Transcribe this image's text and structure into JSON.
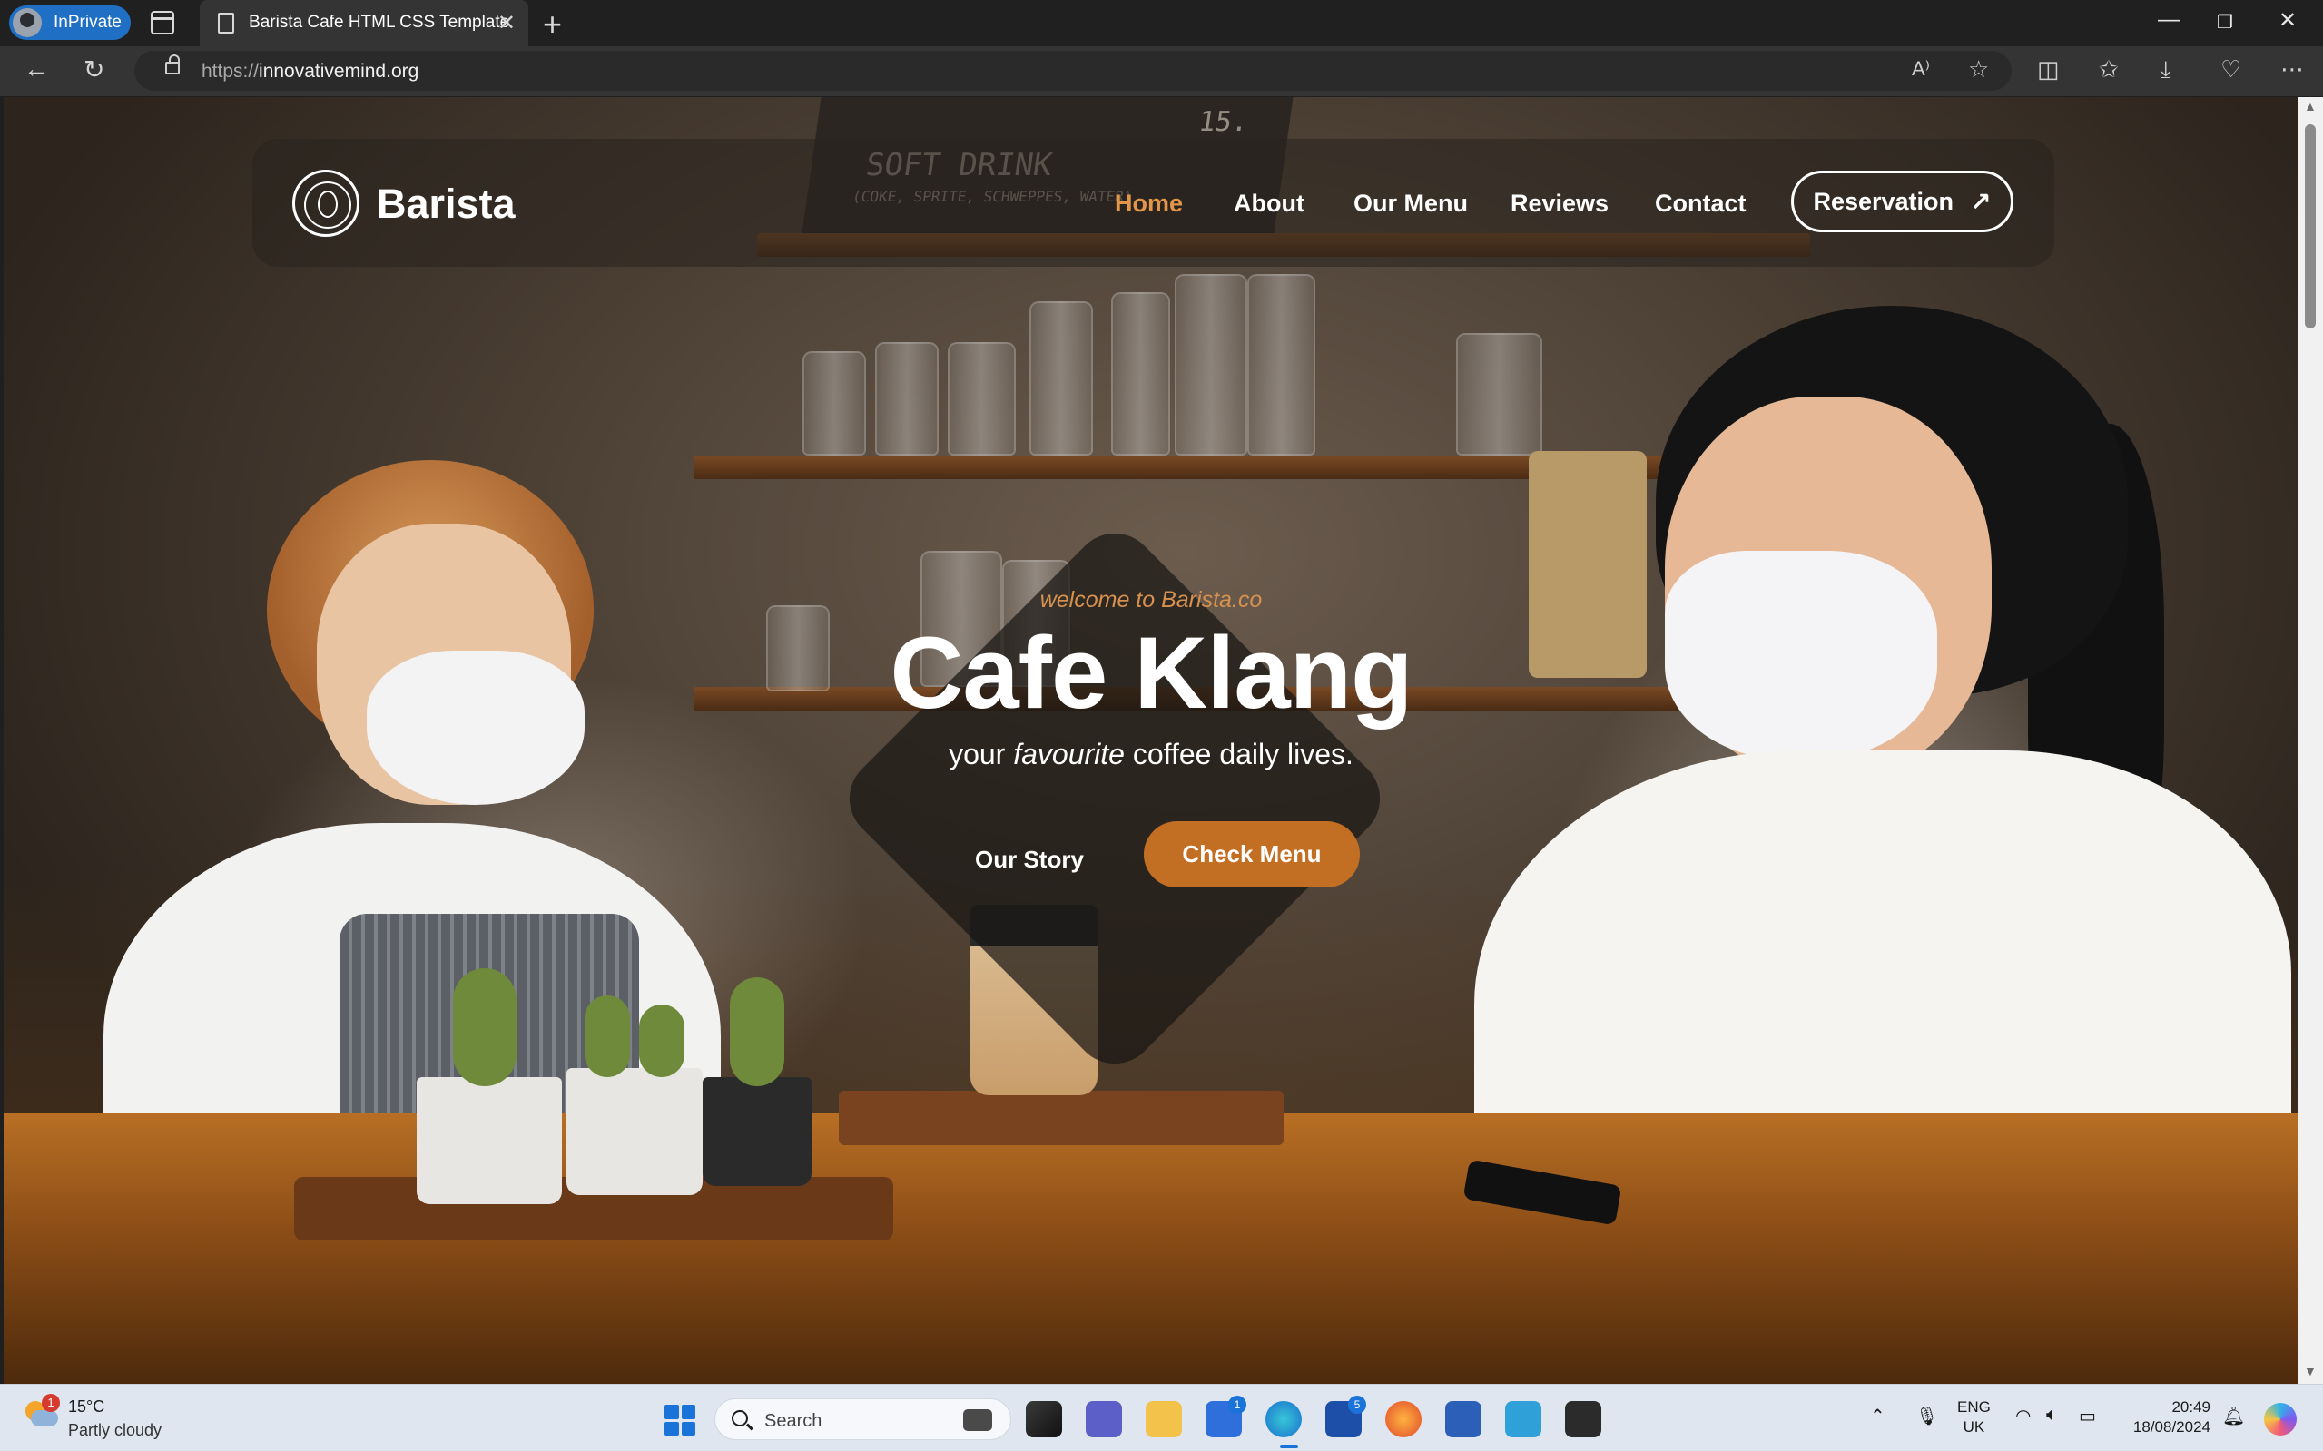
{
  "browser": {
    "inprivate_label": "InPrivate",
    "tab_title": "Barista Cafe HTML CSS Template",
    "url_protocol": "https://",
    "url_host": "innovativemind.org"
  },
  "site": {
    "brand": "Barista",
    "nav": [
      {
        "label": "Home",
        "active": true
      },
      {
        "label": "About",
        "active": false
      },
      {
        "label": "Our Menu",
        "active": false
      },
      {
        "label": "Reviews",
        "active": false
      },
      {
        "label": "Contact",
        "active": false
      }
    ],
    "reservation_label": "Reservation",
    "accent_color": "#e3954a",
    "button_color": "#c36f23"
  },
  "hero": {
    "welcome": "welcome to Barista.co",
    "title": "Cafe Klang",
    "subtitle_pre": "your",
    "subtitle_em": "favourite",
    "subtitle_post": "coffee daily lives.",
    "story_label": "Our Story",
    "cta_label": "Check Menu"
  },
  "taskbar": {
    "weather_temp": "15°C",
    "weather_desc": "Partly cloudy",
    "weather_badge": "1",
    "search_placeholder": "Search",
    "store_badge": "1",
    "app_l_badge": "5",
    "lang_primary": "ENG",
    "lang_region": "UK",
    "time": "20:49",
    "date": "18/08/2024"
  }
}
